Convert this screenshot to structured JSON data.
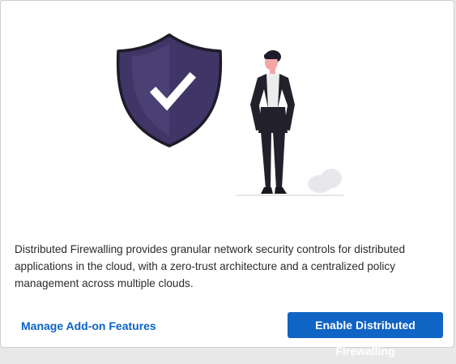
{
  "dialog": {
    "description": "Distributed Firewalling provides granular network security controls for distributed applications in the cloud, with a zero-trust architecture and a centralized policy management across multiple clouds.",
    "actions": {
      "secondary_label": "Manage Add-on Features",
      "primary_label": "Enable Distributed Firewalling"
    }
  },
  "illustration": {
    "icons": [
      "shield-check-icon",
      "person-figure",
      "plant-bush"
    ]
  },
  "colors": {
    "primary": "#0f64c4",
    "link": "#0b63c5",
    "shield": "#3f3566",
    "shield_dark": "#2c2440",
    "text": "#2b2b2b"
  }
}
